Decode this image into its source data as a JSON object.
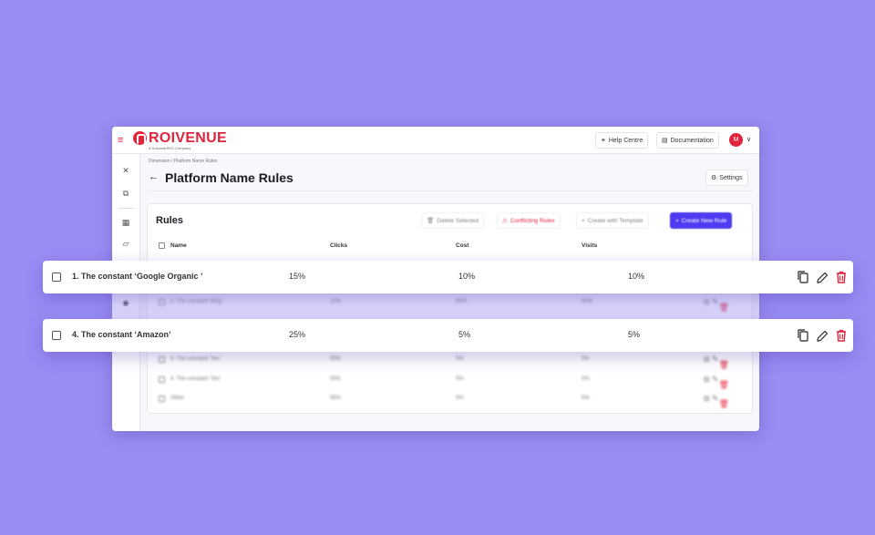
{
  "app": {
    "logo": "ROIVENUE",
    "logo_sub": "A ScanmarSEO Company",
    "avatar_initial": "M",
    "accent": "#e0243b",
    "primary": "#4f3cf0"
  },
  "topbar": {
    "help_label": "Help Centre",
    "docs_label": "Documentation"
  },
  "breadcrumb": "Dimension / Platform Name Rules",
  "page_title": "Platform Name Rules",
  "settings_label": "Settings",
  "rules": {
    "title": "Rules",
    "actions": {
      "delete_selected": "Delete Selected",
      "conflicting_rules": "Conflicting Rules",
      "create_with_template": "Create with Template",
      "create_new_rule": "Create New Rule"
    },
    "columns": [
      "Name",
      "Clicks",
      "Cost",
      "Visits"
    ],
    "blurred_rows": [
      {
        "name": "2. The constant 'Bing'",
        "clicks": "10%",
        "cost": "80%",
        "visits": "80%"
      },
      {
        "name": "4. The constant 'Yes'",
        "clicks": "55%",
        "cost": "5%",
        "visits": "5%"
      },
      {
        "name": "4. The constant 'Yes'",
        "clicks": "55%",
        "cost": "5%",
        "visits": "5%"
      },
      {
        "name": "Other",
        "clicks": "55%",
        "cost": "5%",
        "visits": "5%"
      }
    ]
  },
  "highlight_rows": [
    {
      "name": "1. The constant ‘Google Organic ’",
      "clicks": "15%",
      "cost": "10%",
      "visits": "10%"
    },
    {
      "name": "4. The constant ‘Amazon’",
      "clicks": "25%",
      "cost": "5%",
      "visits": "5%"
    }
  ]
}
